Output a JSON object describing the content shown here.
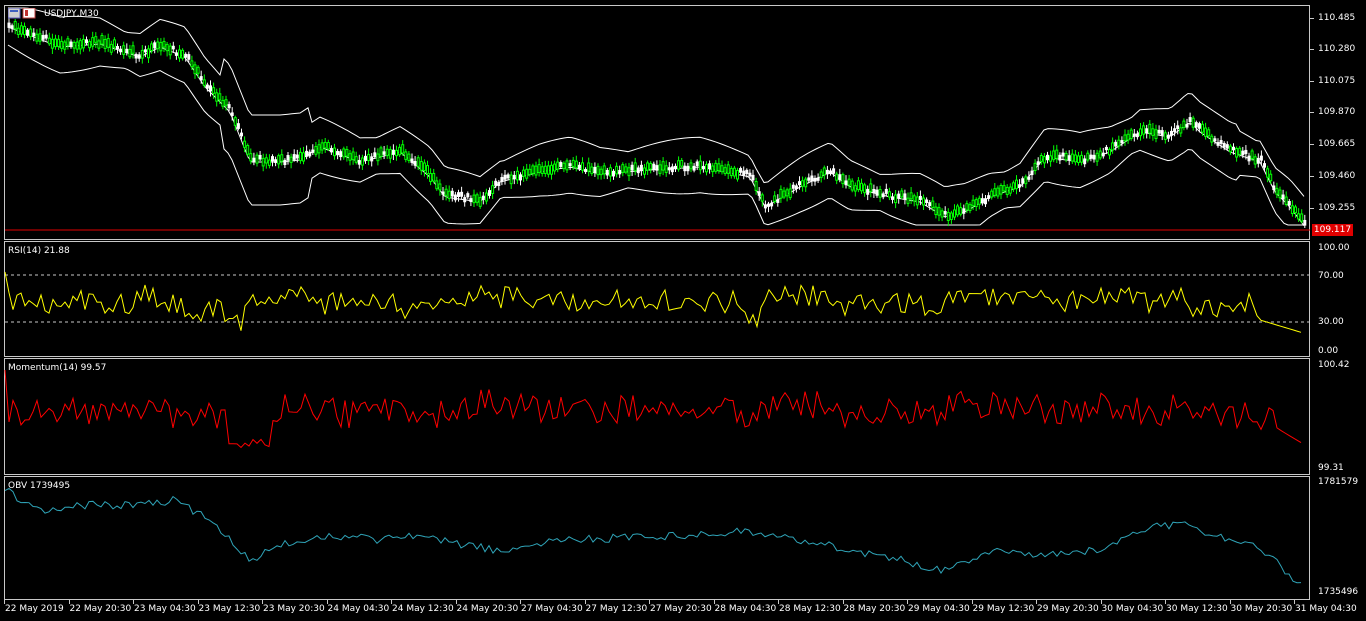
{
  "main": {
    "symbol_label": "USDJPY,M30",
    "flag_icon": "us-jp-flag-icon",
    "price_ticks": [
      "110.485",
      "110.280",
      "110.075",
      "109.870",
      "109.665",
      "109.460",
      "109.255"
    ],
    "current_price": "109.117",
    "current_price_value": 109.117,
    "bollinger_color": "#ffffff",
    "bull_color": "#00ff00",
    "bear_color": "#ffffff"
  },
  "rsi": {
    "label": "RSI(14) 21.88",
    "ticks": [
      "100.00",
      "70.00",
      "30.00",
      "0.00"
    ],
    "levels": [
      70,
      30
    ],
    "line_color": "#ffff00"
  },
  "momentum": {
    "label": "Momentum(14) 99.57",
    "ticks": [
      "100.42",
      "99.31"
    ],
    "line_color": "#ff0000"
  },
  "obv": {
    "label": "OBV 1739495",
    "ticks": [
      "1781579",
      "1735496"
    ],
    "line_color": "#2fa4b8"
  },
  "time_axis": [
    "22 May 2019",
    "22 May 20:30",
    "23 May 04:30",
    "23 May 12:30",
    "23 May 20:30",
    "24 May 04:30",
    "24 May 12:30",
    "24 May 20:30",
    "27 May 04:30",
    "27 May 12:30",
    "27 May 20:30",
    "28 May 04:30",
    "28 May 12:30",
    "28 May 20:30",
    "29 May 04:30",
    "29 May 12:30",
    "29 May 20:30",
    "30 May 04:30",
    "30 May 12:30",
    "30 May 20:30",
    "31 May 04:30"
  ]
}
